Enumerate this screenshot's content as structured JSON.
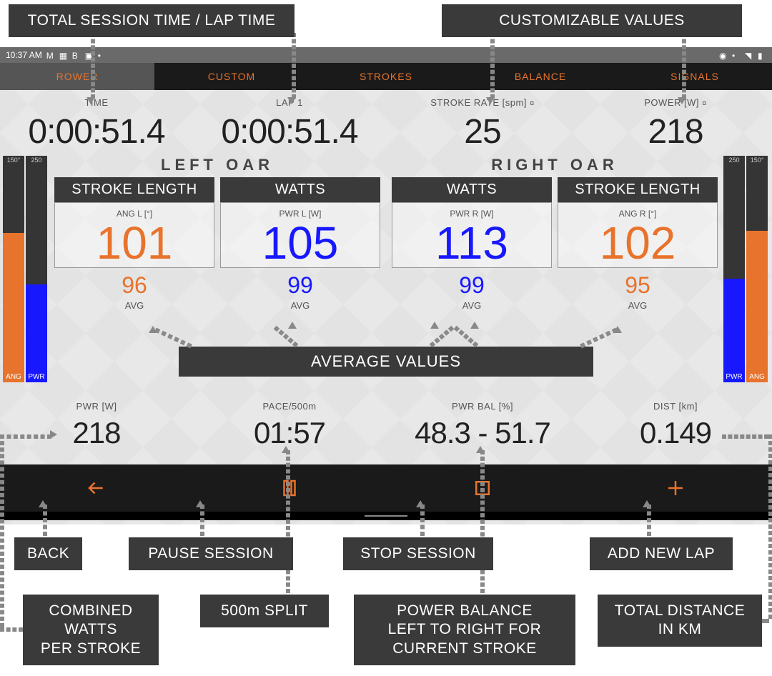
{
  "annotations": {
    "top_left": "TOTAL SESSION TIME / LAP TIME",
    "top_right": "CUSTOMIZABLE VALUES",
    "avg_label": "AVERAGE VALUES",
    "back": "BACK",
    "pause": "PAUSE SESSION",
    "stop": "STOP SESSION",
    "addlap": "ADD NEW LAP",
    "combined": "COMBINED\nWATTS\nPER STROKE",
    "split": "500m SPLIT",
    "balance": "POWER BALANCE\nLEFT TO RIGHT FOR\nCURRENT STROKE",
    "dist": "TOTAL DISTANCE\nIN KM"
  },
  "status_bar": {
    "time": "10:37 AM",
    "icons_left": [
      "mail-icon",
      "grid-icon",
      "bold-icon",
      "layers-icon",
      "dot-icon"
    ],
    "icons_right": [
      "eye-icon",
      "dot-icon",
      "wifi-icon",
      "battery-icon"
    ]
  },
  "tabs": [
    "ROWER",
    "CUSTOM",
    "STROKES",
    "BALANCE",
    "SIGNALS"
  ],
  "active_tab": 0,
  "top": {
    "time_label": "TIME",
    "time_value": "0:00:51.4",
    "lap_label": "LAP 1",
    "lap_value": "0:00:51.4",
    "sr_label": "STROKE RATE [spm]",
    "sr_value": "25",
    "pwr_label": "POWER [W]",
    "pwr_value": "218",
    "gear": "¤"
  },
  "sidebars": {
    "left_ang_scale": "150°",
    "left_pwr_scale": "250",
    "right_pwr_scale": "250",
    "right_ang_scale": "150°",
    "ang_label": "ANG",
    "pwr_label": "PWR"
  },
  "oars": {
    "left_title": "LEFT OAR",
    "right_title": "RIGHT OAR",
    "panel_stroke": "STROKE LENGTH",
    "panel_watts": "WATTS",
    "avg_label": "AVG",
    "left": {
      "ang_label": "ANG L [°]",
      "ang_value": "101",
      "ang_avg": "96",
      "pwr_label": "PWR L [W]",
      "pwr_value": "105",
      "pwr_avg": "99"
    },
    "right": {
      "pwr_label": "PWR R [W]",
      "pwr_value": "113",
      "pwr_avg": "99",
      "ang_label": "ANG R [°]",
      "ang_value": "102",
      "ang_avg": "95"
    }
  },
  "bottom": {
    "pwr_label": "PWR [W]",
    "pwr_value": "218",
    "pace_label": "PACE/500m",
    "pace_value": "01:57",
    "bal_label": "PWR BAL [%]",
    "bal_value": "48.3 - 51.7",
    "dist_label": "DIST [km]",
    "dist_value": "0.149"
  },
  "controls": [
    "back",
    "pause",
    "stop",
    "add-lap"
  ]
}
